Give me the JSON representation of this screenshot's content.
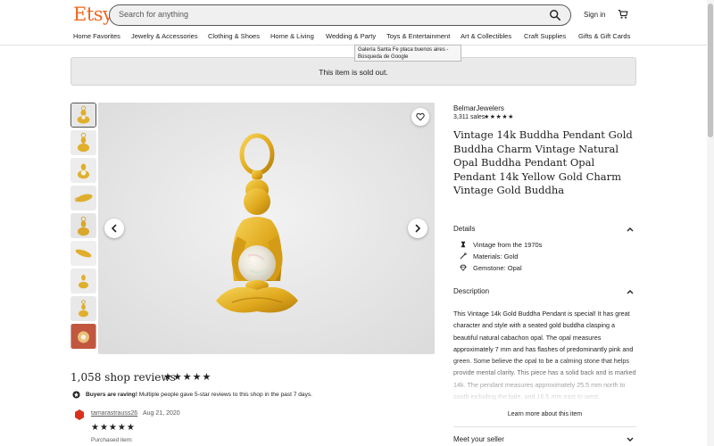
{
  "header": {
    "logo": "Etsy",
    "search_placeholder": "Search for anything",
    "signin_label": "Sign in",
    "nav": [
      "Home Favorites",
      "Jewelry & Accessories",
      "Clothing & Shoes",
      "Home & Living",
      "Wedding & Party",
      "Toys & Entertainment",
      "Art & Collectibles",
      "Craft Supplies",
      "Gifts & Gift Cards"
    ]
  },
  "tooltip": {
    "line1": "Galería Santa Fe placa buenos aires -",
    "line2": "Búsqueda de Google"
  },
  "banner": {
    "text": "This item is sold out."
  },
  "listing": {
    "shop_name": "BelmarJewelers",
    "sales": "3,311 sales",
    "shop_rating_stars": "★★★★★",
    "title": "Vintage 14k Buddha Pendant Gold Buddha Charm Vintage Natural Opal Buddha Pendant Opal Pendant 14k Yellow Gold Charm Vintage Gold Buddha"
  },
  "details": {
    "heading": "Details",
    "items": [
      {
        "icon": "clock-icon",
        "label": "Vintage from the 1970s"
      },
      {
        "icon": "needle-icon",
        "label": "Materials: Gold"
      },
      {
        "icon": "gem-icon",
        "label": "Gemstone: Opal"
      }
    ]
  },
  "description": {
    "heading": "Description",
    "text": "This Vintage 14k Gold Buddha Pendant is special! It has great character and style with a seated gold buddha clasping a beautiful natural cabachon opal. The opal measures approximately 7 mm and has flashes of predominantly pink and green. Some believe the opal to be a calming stone that helps provide mental clarity. This piece has a solid back and is marked 14k. The pendant measures approximately 25.5 mm north to south including the bale, and 16.5 mm east to west.",
    "learn_more": "Learn more about this item"
  },
  "meet_seller": {
    "heading": "Meet your seller"
  },
  "reviews": {
    "heading": "1,058 shop reviews",
    "stars": "★★★★★",
    "raving_bold": "Buyers are raving!",
    "raving_text": " Multiple people gave 5-star reviews to this shop in the past 7 days.",
    "reviewer": "tamarastrauss26",
    "date": "Aug 21, 2020",
    "review_stars": "★★★★★",
    "purchased_label": "Purchased item:"
  },
  "colors": {
    "brand": "#f1641e",
    "banner_bg": "#eaeaea",
    "image_bg": "#e9e9ea",
    "gold": "#e3b42a"
  }
}
